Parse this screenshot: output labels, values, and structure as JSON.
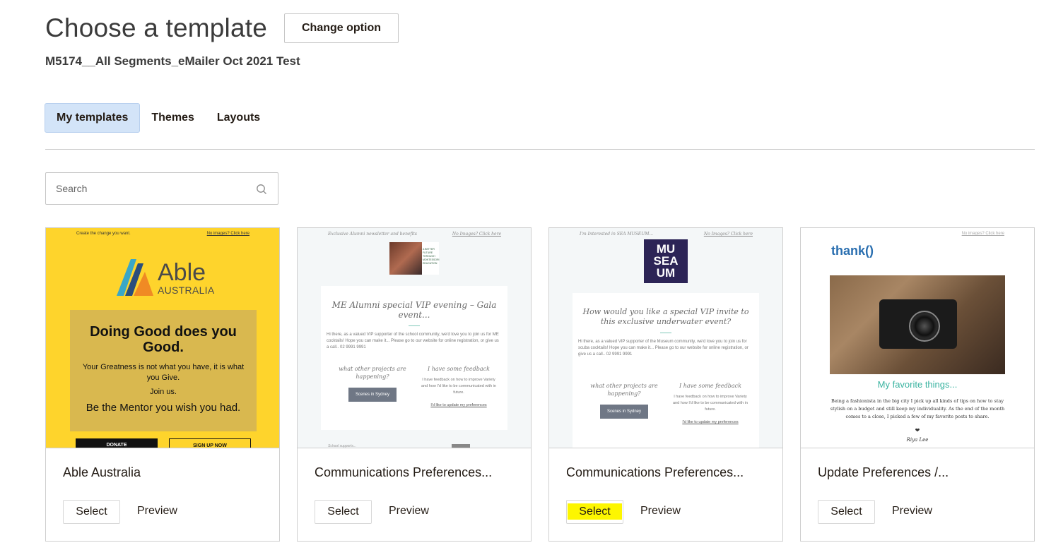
{
  "header": {
    "title": "Choose a template",
    "change_option_label": "Change option",
    "campaign_name": "M5174__All Segments_eMailer Oct 2021 Test"
  },
  "tabs": [
    {
      "label": "My templates",
      "active": true
    },
    {
      "label": "Themes",
      "active": false
    },
    {
      "label": "Layouts",
      "active": false
    }
  ],
  "search": {
    "placeholder": "Search"
  },
  "templates": [
    {
      "name": "Able Australia",
      "select_label": "Select",
      "preview_label": "Preview",
      "thumbnail": {
        "top_left": "Create the change you want.",
        "top_right": "No images? Click here",
        "logo_name": "Able",
        "logo_sub": "AUSTRALIA",
        "headline": "Doing Good does you Good.",
        "line1": "Your Greatness is not what you have, it is what you Give.",
        "line2": "Join us.",
        "line3": "Be the Mentor you wish you had.",
        "btn1": "DONATE",
        "btn2": "SIGN UP NOW"
      }
    },
    {
      "name": "Communications Preferences...",
      "select_label": "Select",
      "preview_label": "Preview",
      "thumbnail": {
        "top_left": "Exclusive Alumni newsletter and benefits",
        "top_right": "No Images? Click here",
        "headline": "ME Alumni special VIP evening – Gala event...",
        "body": "Hi there, as a valued VIP supporter of the school community, we'd love you to join us for ME cocktails! Hope you can make it... Please go to our website for online registration, or give us a call.. 02 9991 9991",
        "col1_title": "what other projects are happening?",
        "col1_btn": "Scenes in Sydney",
        "col2_title": "I have some feedback",
        "col2_body": "I have feedback on how to improve Variety and how I'd like to be communicated with in future.",
        "col2_link": "I'd like to update my preferences",
        "footer": "School supports...",
        "promo": "A BETTER FUTURE THROUGH MONTESSORI EDUCATION"
      }
    },
    {
      "name": "Communications Preferences...",
      "select_label": "Select",
      "preview_label": "Preview",
      "select_highlighted": true,
      "thumbnail": {
        "top_left": "I'm Interested in SEA MUSEUM...",
        "top_right": "No Images? Click here",
        "logo": "MU SEA UM",
        "headline": "How would you like a special VIP invite to this exclusive underwater event?",
        "body": "Hi there, as a valued VIP supporter of the Museum community, we'd love you to join us for scuba cocktails! Hope you can make it... Please go to our website for online registration, or give us a call.. 02 9991 9991",
        "col1_title": "what other projects are happening?",
        "col1_btn": "Scenes in Sydney",
        "col2_title": "I have some feedback",
        "col2_body": "I have feedback on how to improve Variety and how I'd like to be communicated with in future.",
        "col2_link": "I'd like to update my preferences"
      }
    },
    {
      "name": "Update Preferences /...",
      "select_label": "Select",
      "preview_label": "Preview",
      "thumbnail": {
        "top_right": "No images? Click here",
        "brand": "thank()",
        "heading": "My favorite things...",
        "text": "Being a fashionista in the big city I pick up all kinds of tips on how to stay stylish on a budget and still keep my individuality. As the end of the month comes to a close, I picked a few of my favorite posts to share.",
        "heart": "❤",
        "signature": "Riya Lee"
      }
    }
  ]
}
